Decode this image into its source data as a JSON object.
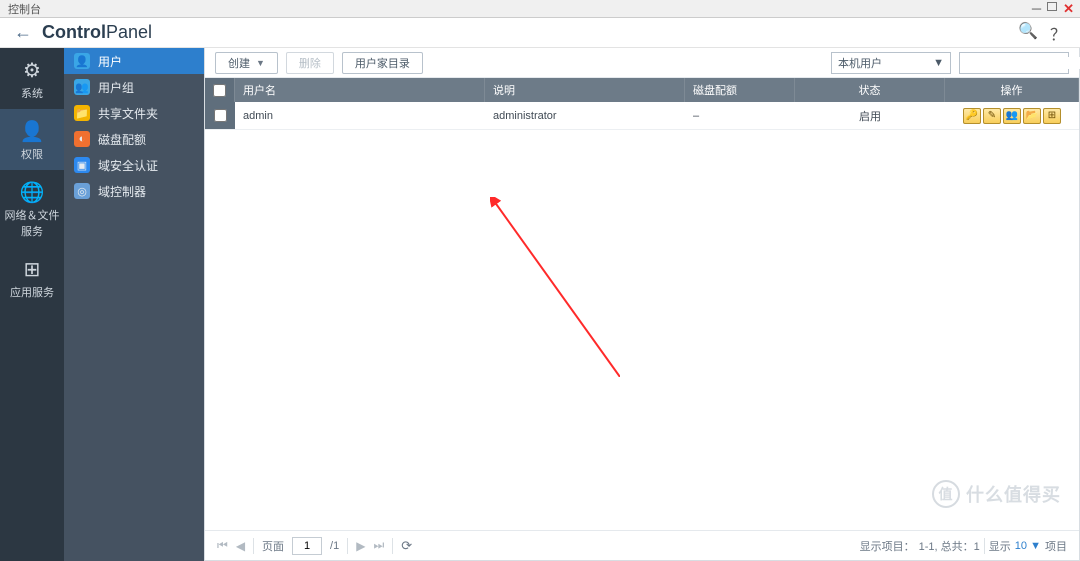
{
  "window": {
    "title": "控制台"
  },
  "header": {
    "title_bold": "Control",
    "title_light": "Panel"
  },
  "nav1": [
    {
      "label": "系统",
      "icon": "⚙"
    },
    {
      "label": "权限",
      "icon": "👤",
      "active": true
    },
    {
      "label": "网络＆文件服务",
      "icon": "🌐"
    },
    {
      "label": "应用服务",
      "icon": "⊞"
    }
  ],
  "nav2": [
    {
      "label": "用户",
      "active": true
    },
    {
      "label": "用户组"
    },
    {
      "label": "共享文件夹"
    },
    {
      "label": "磁盘配额"
    },
    {
      "label": "域安全认证"
    },
    {
      "label": "域控制器"
    }
  ],
  "toolbar": {
    "create_label": "创建",
    "delete_label": "删除",
    "homedir_label": "用户家目录",
    "filter_selected": "本机用户"
  },
  "table": {
    "columns": {
      "name": "用户名",
      "desc": "说明",
      "quota": "磁盘配额",
      "status": "状态",
      "actions": "操作"
    },
    "rows": [
      {
        "name": "admin",
        "desc": "administrator",
        "quota": "–",
        "status": "启用"
      }
    ]
  },
  "pager": {
    "page_label": "页面",
    "page_value": "1",
    "page_total": "/1",
    "summary_prefix": "显示项目：",
    "summary_range": "1-1, 总共：1",
    "show_label": "显示",
    "show_count": "10",
    "items_label": "项目"
  },
  "watermark": "什么值得买"
}
